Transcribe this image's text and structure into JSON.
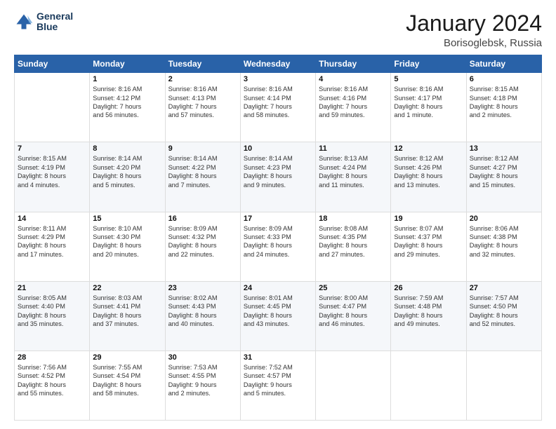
{
  "header": {
    "logo_line1": "General",
    "logo_line2": "Blue",
    "month": "January 2024",
    "location": "Borisoglebsk, Russia"
  },
  "weekdays": [
    "Sunday",
    "Monday",
    "Tuesday",
    "Wednesday",
    "Thursday",
    "Friday",
    "Saturday"
  ],
  "rows": [
    [
      {
        "day": "",
        "text": ""
      },
      {
        "day": "1",
        "text": "Sunrise: 8:16 AM\nSunset: 4:12 PM\nDaylight: 7 hours\nand 56 minutes."
      },
      {
        "day": "2",
        "text": "Sunrise: 8:16 AM\nSunset: 4:13 PM\nDaylight: 7 hours\nand 57 minutes."
      },
      {
        "day": "3",
        "text": "Sunrise: 8:16 AM\nSunset: 4:14 PM\nDaylight: 7 hours\nand 58 minutes."
      },
      {
        "day": "4",
        "text": "Sunrise: 8:16 AM\nSunset: 4:16 PM\nDaylight: 7 hours\nand 59 minutes."
      },
      {
        "day": "5",
        "text": "Sunrise: 8:16 AM\nSunset: 4:17 PM\nDaylight: 8 hours\nand 1 minute."
      },
      {
        "day": "6",
        "text": "Sunrise: 8:15 AM\nSunset: 4:18 PM\nDaylight: 8 hours\nand 2 minutes."
      }
    ],
    [
      {
        "day": "7",
        "text": "Sunrise: 8:15 AM\nSunset: 4:19 PM\nDaylight: 8 hours\nand 4 minutes."
      },
      {
        "day": "8",
        "text": "Sunrise: 8:14 AM\nSunset: 4:20 PM\nDaylight: 8 hours\nand 5 minutes."
      },
      {
        "day": "9",
        "text": "Sunrise: 8:14 AM\nSunset: 4:22 PM\nDaylight: 8 hours\nand 7 minutes."
      },
      {
        "day": "10",
        "text": "Sunrise: 8:14 AM\nSunset: 4:23 PM\nDaylight: 8 hours\nand 9 minutes."
      },
      {
        "day": "11",
        "text": "Sunrise: 8:13 AM\nSunset: 4:24 PM\nDaylight: 8 hours\nand 11 minutes."
      },
      {
        "day": "12",
        "text": "Sunrise: 8:12 AM\nSunset: 4:26 PM\nDaylight: 8 hours\nand 13 minutes."
      },
      {
        "day": "13",
        "text": "Sunrise: 8:12 AM\nSunset: 4:27 PM\nDaylight: 8 hours\nand 15 minutes."
      }
    ],
    [
      {
        "day": "14",
        "text": "Sunrise: 8:11 AM\nSunset: 4:29 PM\nDaylight: 8 hours\nand 17 minutes."
      },
      {
        "day": "15",
        "text": "Sunrise: 8:10 AM\nSunset: 4:30 PM\nDaylight: 8 hours\nand 20 minutes."
      },
      {
        "day": "16",
        "text": "Sunrise: 8:09 AM\nSunset: 4:32 PM\nDaylight: 8 hours\nand 22 minutes."
      },
      {
        "day": "17",
        "text": "Sunrise: 8:09 AM\nSunset: 4:33 PM\nDaylight: 8 hours\nand 24 minutes."
      },
      {
        "day": "18",
        "text": "Sunrise: 8:08 AM\nSunset: 4:35 PM\nDaylight: 8 hours\nand 27 minutes."
      },
      {
        "day": "19",
        "text": "Sunrise: 8:07 AM\nSunset: 4:37 PM\nDaylight: 8 hours\nand 29 minutes."
      },
      {
        "day": "20",
        "text": "Sunrise: 8:06 AM\nSunset: 4:38 PM\nDaylight: 8 hours\nand 32 minutes."
      }
    ],
    [
      {
        "day": "21",
        "text": "Sunrise: 8:05 AM\nSunset: 4:40 PM\nDaylight: 8 hours\nand 35 minutes."
      },
      {
        "day": "22",
        "text": "Sunrise: 8:03 AM\nSunset: 4:41 PM\nDaylight: 8 hours\nand 37 minutes."
      },
      {
        "day": "23",
        "text": "Sunrise: 8:02 AM\nSunset: 4:43 PM\nDaylight: 8 hours\nand 40 minutes."
      },
      {
        "day": "24",
        "text": "Sunrise: 8:01 AM\nSunset: 4:45 PM\nDaylight: 8 hours\nand 43 minutes."
      },
      {
        "day": "25",
        "text": "Sunrise: 8:00 AM\nSunset: 4:47 PM\nDaylight: 8 hours\nand 46 minutes."
      },
      {
        "day": "26",
        "text": "Sunrise: 7:59 AM\nSunset: 4:48 PM\nDaylight: 8 hours\nand 49 minutes."
      },
      {
        "day": "27",
        "text": "Sunrise: 7:57 AM\nSunset: 4:50 PM\nDaylight: 8 hours\nand 52 minutes."
      }
    ],
    [
      {
        "day": "28",
        "text": "Sunrise: 7:56 AM\nSunset: 4:52 PM\nDaylight: 8 hours\nand 55 minutes."
      },
      {
        "day": "29",
        "text": "Sunrise: 7:55 AM\nSunset: 4:54 PM\nDaylight: 8 hours\nand 58 minutes."
      },
      {
        "day": "30",
        "text": "Sunrise: 7:53 AM\nSunset: 4:55 PM\nDaylight: 9 hours\nand 2 minutes."
      },
      {
        "day": "31",
        "text": "Sunrise: 7:52 AM\nSunset: 4:57 PM\nDaylight: 9 hours\nand 5 minutes."
      },
      {
        "day": "",
        "text": ""
      },
      {
        "day": "",
        "text": ""
      },
      {
        "day": "",
        "text": ""
      }
    ]
  ]
}
